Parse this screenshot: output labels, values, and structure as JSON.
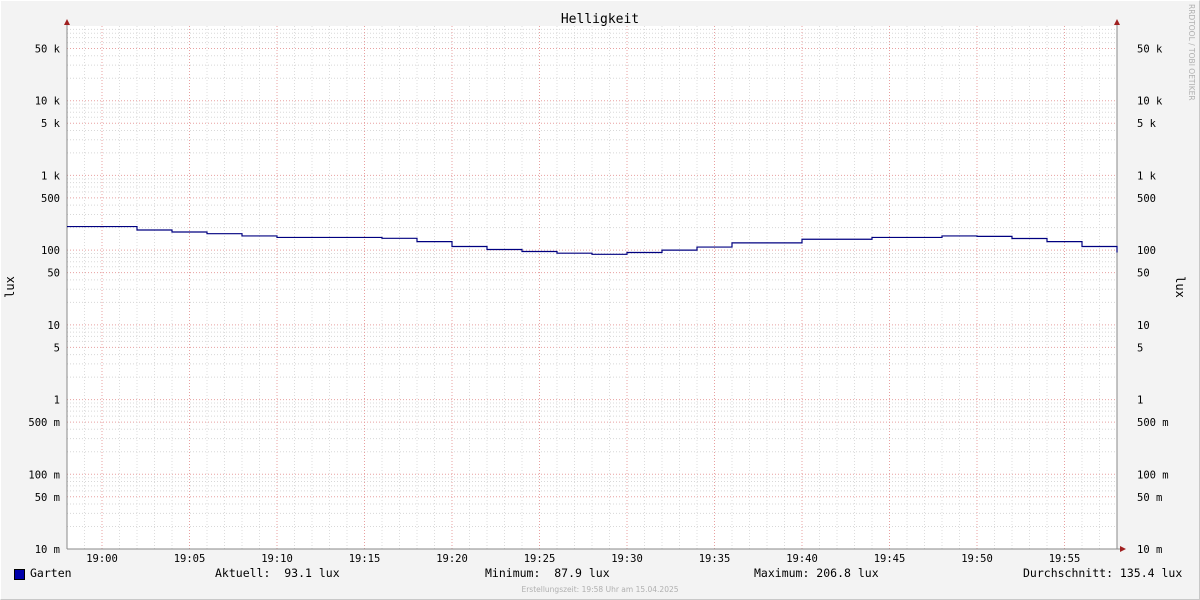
{
  "chart_data": {
    "type": "line",
    "title": "Helligkeit",
    "ylabel": "lux",
    "ylabel_right": "lux",
    "scale": "log",
    "ylim": [
      0.01,
      100000
    ],
    "y_ticks": [
      {
        "v": 50000,
        "label": "50 k"
      },
      {
        "v": 10000,
        "label": "10 k"
      },
      {
        "v": 5000,
        "label": "5 k"
      },
      {
        "v": 1000,
        "label": "1 k"
      },
      {
        "v": 500,
        "label": "500"
      },
      {
        "v": 100,
        "label": "100"
      },
      {
        "v": 50,
        "label": "50"
      },
      {
        "v": 10,
        "label": "10"
      },
      {
        "v": 5,
        "label": "5"
      },
      {
        "v": 1,
        "label": "1"
      },
      {
        "v": 0.5,
        "label": "500 m"
      },
      {
        "v": 0.1,
        "label": "100 m"
      },
      {
        "v": 0.05,
        "label": "50 m"
      },
      {
        "v": 0.01,
        "label": "10 m"
      }
    ],
    "x_ticks": [
      "19:00",
      "19:05",
      "19:10",
      "19:15",
      "19:20",
      "19:25",
      "19:30",
      "19:35",
      "19:40",
      "19:45",
      "19:50",
      "19:55"
    ],
    "grid": true,
    "legend": "bottom-left",
    "series": [
      {
        "name": "Garten",
        "color": "#000080",
        "x": [
          "18:58",
          "19:02",
          "19:04",
          "19:06",
          "19:08",
          "19:10",
          "19:14",
          "19:16",
          "19:18",
          "19:20",
          "19:22",
          "19:24",
          "19:26",
          "19:28",
          "19:30",
          "19:32",
          "19:34",
          "19:36",
          "19:40",
          "19:44",
          "19:48",
          "19:50",
          "19:52",
          "19:54",
          "19:56",
          "19:58"
        ],
        "values": [
          206.8,
          186,
          175,
          166,
          155,
          148,
          148,
          144,
          130,
          112,
          102,
          96,
          91,
          87.9,
          93,
          100,
          110,
          125,
          140,
          148,
          155,
          153,
          143,
          130,
          112,
          93.1
        ]
      }
    ]
  },
  "legend": {
    "series_name": "Garten",
    "series_color": "#0000aa",
    "current": "Aktuell:  93.1 lux",
    "minimum": "Minimum:  87.9 lux",
    "maximum": "Maximum: 206.8 lux",
    "average": "Durchschnitt: 135.4 lux"
  },
  "footer": "Erstellungszeit: 19:58 Uhr am 15.04.2025",
  "watermark": "RRDTOOL / TOBI OETIKER"
}
